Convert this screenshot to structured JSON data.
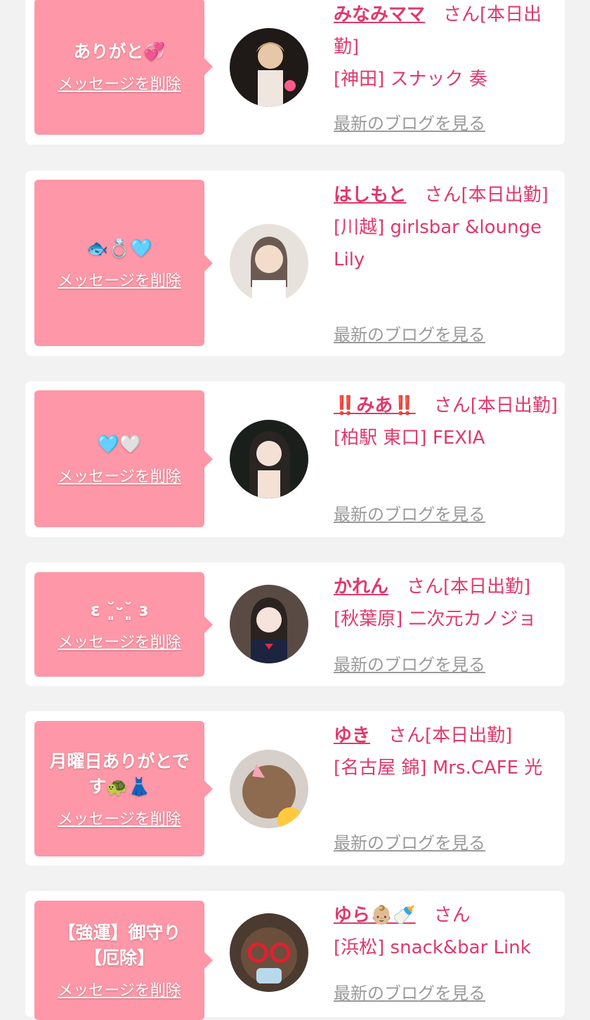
{
  "delete_label": "メッセージを削除",
  "blog_label": "最新のブログを見る",
  "entries": [
    {
      "message": "ありがと💞",
      "name": "みなみママ",
      "suffix": "さん[本日出勤]",
      "shop": "[神田] スナック 奏"
    },
    {
      "message": "🐟💍🩵",
      "name": "はしもと",
      "suffix": "さん[本日出勤]",
      "shop": "[川越] girlsbar &lounge Lily"
    },
    {
      "message": "🩵🤍",
      "name": "‼️みあ‼️",
      "suffix": "さん[本日出勤]",
      "shop": "[柏駅 東口] FEXIA"
    },
    {
      "message": "ɛ ˘͈ᵕ˘͈ ɜ",
      "name": "かれん",
      "suffix": "さん[本日出勤]",
      "shop": "[秋葉原] 二次元カノジョ"
    },
    {
      "message": "月曜日ありがとです🐢👗",
      "name": "ゆき",
      "suffix": "さん[本日出勤]",
      "shop": "[名古屋 錦] Mrs.CAFE 光"
    },
    {
      "message": "【強運】御守り【厄除】",
      "name": "ゆら👶🏼🍼",
      "suffix": "さん",
      "shop": "[浜松] snack&bar Link"
    }
  ]
}
